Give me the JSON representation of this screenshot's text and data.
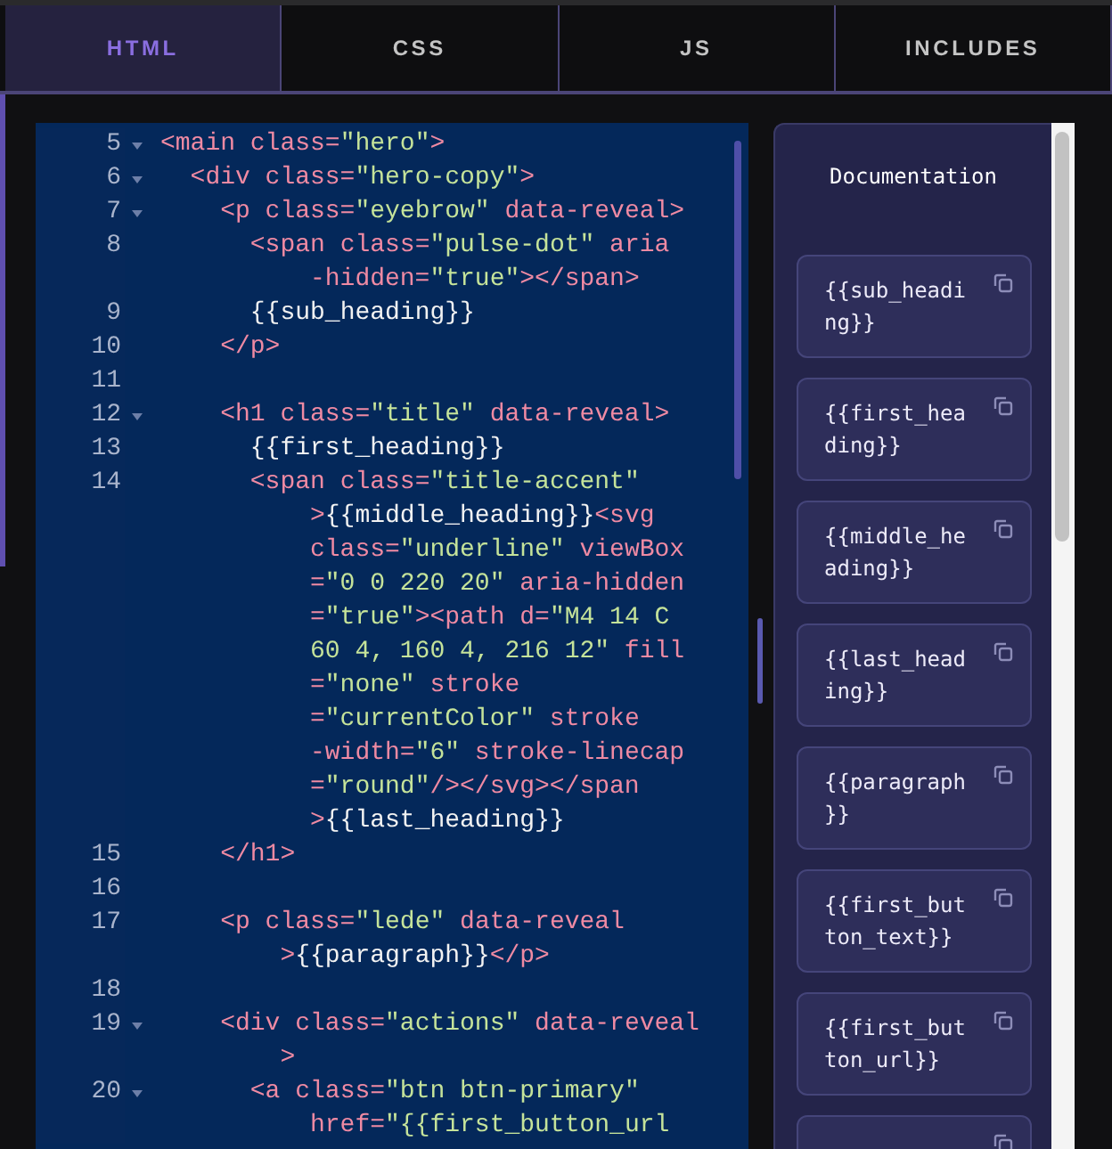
{
  "tabs": [
    {
      "label": "HTML",
      "selected": true
    },
    {
      "label": "CSS",
      "selected": false
    },
    {
      "label": "JS",
      "selected": false
    },
    {
      "label": "INCLUDES",
      "selected": false
    }
  ],
  "editor": {
    "lines": [
      {
        "number": "5",
        "foldable": true,
        "tokens": [
          {
            "kind": "tag",
            "text": "<main class="
          },
          {
            "kind": "str",
            "text": "\"hero\""
          },
          {
            "kind": "tag",
            "text": ">"
          }
        ],
        "children": [
          {
            "number": "6",
            "foldable": true,
            "tokens": [
              {
                "kind": "tag",
                "text": "<div class="
              },
              {
                "kind": "str",
                "text": "\"hero-copy\""
              },
              {
                "kind": "tag",
                "text": ">"
              }
            ],
            "children": [
              {
                "number": "7",
                "foldable": true,
                "tokens": [
                  {
                    "kind": "tag",
                    "text": "<p class="
                  },
                  {
                    "kind": "str",
                    "text": "\"eyebrow\""
                  },
                  {
                    "kind": "tag",
                    "text": " data-reveal>"
                  }
                ],
                "children": [
                  {
                    "number": "8",
                    "foldable": false,
                    "tokens": [
                      {
                        "kind": "tag",
                        "text": "<span class="
                      },
                      {
                        "kind": "str",
                        "text": "\"pulse-dot\""
                      },
                      {
                        "kind": "tag",
                        "text": " aria"
                      }
                    ],
                    "wrap": [
                      {
                        "tokens": [
                          {
                            "kind": "tag",
                            "text": "-hidden="
                          },
                          {
                            "kind": "str",
                            "text": "\"true\""
                          },
                          {
                            "kind": "tag",
                            "text": "></span>"
                          }
                        ]
                      }
                    ]
                  },
                  {
                    "number": "9",
                    "foldable": false,
                    "tokens": [
                      {
                        "kind": "text",
                        "text": "{{sub_heading}}"
                      }
                    ]
                  }
                ]
              },
              {
                "number": "10",
                "foldable": false,
                "tokens": [
                  {
                    "kind": "tag",
                    "text": "</p>"
                  }
                ]
              },
              {
                "number": "11",
                "foldable": false
              },
              {
                "number": "12",
                "foldable": true,
                "tokens": [
                  {
                    "kind": "tag",
                    "text": "<h1 class="
                  },
                  {
                    "kind": "str",
                    "text": "\"title\""
                  },
                  {
                    "kind": "tag",
                    "text": " data-reveal>"
                  }
                ],
                "children": [
                  {
                    "number": "13",
                    "foldable": false,
                    "tokens": [
                      {
                        "kind": "text",
                        "text": "{{first_heading}}"
                      }
                    ]
                  },
                  {
                    "number": "14",
                    "foldable": false,
                    "tokens": [
                      {
                        "kind": "tag",
                        "text": "<span class="
                      },
                      {
                        "kind": "str",
                        "text": "\"title-accent\""
                      }
                    ],
                    "wrap": [
                      {
                        "tokens": [
                          {
                            "kind": "tag",
                            "text": ">"
                          },
                          {
                            "kind": "text",
                            "text": "{{middle_heading}}"
                          },
                          {
                            "kind": "tag",
                            "text": "<svg"
                          }
                        ]
                      },
                      {
                        "tokens": [
                          {
                            "kind": "tag",
                            "text": "class="
                          },
                          {
                            "kind": "str",
                            "text": "\"underline\""
                          },
                          {
                            "kind": "tag",
                            "text": " viewBox"
                          }
                        ]
                      },
                      {
                        "tokens": [
                          {
                            "kind": "tag",
                            "text": "="
                          },
                          {
                            "kind": "str",
                            "text": "\"0 0 220 20\""
                          },
                          {
                            "kind": "tag",
                            "text": " aria-hidden"
                          }
                        ]
                      },
                      {
                        "tokens": [
                          {
                            "kind": "tag",
                            "text": "="
                          },
                          {
                            "kind": "str",
                            "text": "\"true\""
                          },
                          {
                            "kind": "tag",
                            "text": "><path d="
                          },
                          {
                            "kind": "str",
                            "text": "\"M4 14 C"
                          }
                        ]
                      },
                      {
                        "tokens": [
                          {
                            "kind": "str",
                            "text": "60 4, 160 4, 216 12\""
                          },
                          {
                            "kind": "tag",
                            "text": " fill"
                          }
                        ]
                      },
                      {
                        "tokens": [
                          {
                            "kind": "tag",
                            "text": "="
                          },
                          {
                            "kind": "str",
                            "text": "\"none\""
                          },
                          {
                            "kind": "tag",
                            "text": " stroke"
                          }
                        ]
                      },
                      {
                        "tokens": [
                          {
                            "kind": "tag",
                            "text": "="
                          },
                          {
                            "kind": "str",
                            "text": "\"currentColor\""
                          },
                          {
                            "kind": "tag",
                            "text": " stroke"
                          }
                        ]
                      },
                      {
                        "tokens": [
                          {
                            "kind": "tag",
                            "text": "-width="
                          },
                          {
                            "kind": "str",
                            "text": "\"6\""
                          },
                          {
                            "kind": "tag",
                            "text": " stroke-linecap"
                          }
                        ]
                      },
                      {
                        "tokens": [
                          {
                            "kind": "tag",
                            "text": "="
                          },
                          {
                            "kind": "str",
                            "text": "\"round\""
                          },
                          {
                            "kind": "tag",
                            "text": "/></svg></span"
                          }
                        ]
                      },
                      {
                        "tokens": [
                          {
                            "kind": "tag",
                            "text": ">"
                          },
                          {
                            "kind": "text",
                            "text": "{{last_heading}}"
                          }
                        ]
                      }
                    ]
                  }
                ]
              },
              {
                "number": "15",
                "foldable": false,
                "tokens": [
                  {
                    "kind": "tag",
                    "text": "</h1>"
                  }
                ]
              },
              {
                "number": "16",
                "foldable": false
              },
              {
                "number": "17",
                "foldable": false,
                "tokens": [
                  {
                    "kind": "tag",
                    "text": "<p class="
                  },
                  {
                    "kind": "str",
                    "text": "\"lede\""
                  },
                  {
                    "kind": "tag",
                    "text": " data-reveal"
                  }
                ],
                "wrap": [
                  {
                    "tokens": [
                      {
                        "kind": "tag",
                        "text": ">"
                      },
                      {
                        "kind": "text",
                        "text": "{{paragraph}}"
                      },
                      {
                        "kind": "tag",
                        "text": "</p>"
                      }
                    ]
                  }
                ]
              },
              {
                "number": "18",
                "foldable": false
              },
              {
                "number": "19",
                "foldable": true,
                "tokens": [
                  {
                    "kind": "tag",
                    "text": "<div class="
                  },
                  {
                    "kind": "str",
                    "text": "\"actions\""
                  },
                  {
                    "kind": "tag",
                    "text": " data-reveal"
                  }
                ],
                "wrap": [
                  {
                    "tokens": [
                      {
                        "kind": "tag",
                        "text": ">"
                      }
                    ]
                  }
                ],
                "children": [
                  {
                    "number": "20",
                    "foldable": true,
                    "tokens": [
                      {
                        "kind": "tag",
                        "text": "<a class="
                      },
                      {
                        "kind": "str",
                        "text": "\"btn btn-primary\""
                      }
                    ],
                    "wrap": [
                      {
                        "tokens": [
                          {
                            "kind": "tag",
                            "text": "href="
                          },
                          {
                            "kind": "str",
                            "text": "\"{{first_button_url"
                          }
                        ]
                      }
                    ]
                  }
                ]
              }
            ]
          }
        ]
      }
    ]
  },
  "documentation": {
    "title": "Documentation",
    "items": [
      {
        "kind": "snippet",
        "text": "{{sub_heading}}"
      },
      {
        "kind": "snippet",
        "text": "{{first_heading}}"
      },
      {
        "kind": "snippet",
        "text": "{{middle_heading}}"
      },
      {
        "kind": "snippet",
        "text": "{{last_heading}}"
      },
      {
        "kind": "snippet",
        "text": "{{paragraph}}"
      },
      {
        "kind": "snippet",
        "text": "{{first_button_text}}"
      },
      {
        "kind": "snippet",
        "text": "{{first_button_url}}"
      },
      {
        "kind": "partial"
      }
    ]
  }
}
